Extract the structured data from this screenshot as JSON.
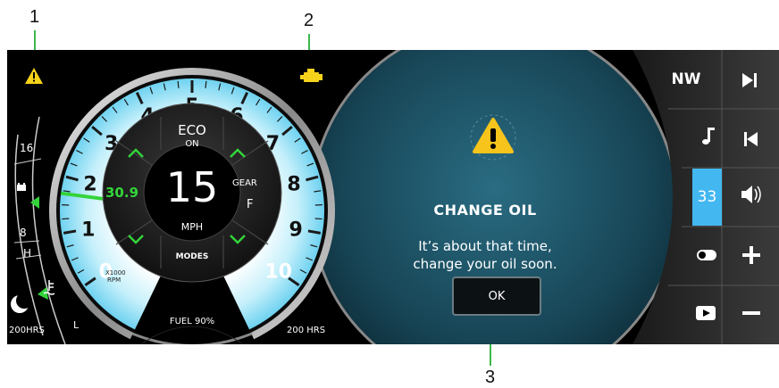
{
  "callouts": {
    "one": "1",
    "two": "2",
    "three": "3"
  },
  "gauge": {
    "tach_numbers": [
      "0",
      "1",
      "2",
      "3",
      "4",
      "5",
      "6",
      "7",
      "8",
      "9",
      "10"
    ],
    "rpm_unit_top": "X1000",
    "rpm_unit_bottom": "RPM",
    "speed": "15",
    "speed_unit": "MPH",
    "eco_label": "ECO",
    "eco_state": "ON",
    "gear_label": "GEAR",
    "gear_value": "F",
    "modes_label": "MODES",
    "trim_value": "30.9",
    "fuel_label": "FUEL 90%",
    "fuel_percent": 90,
    "rpm_value": 1.7
  },
  "left_scale": {
    "top_label": "16",
    "mid_label": "8",
    "high_label": "H",
    "low_label": "L",
    "hours_left": "200HRS"
  },
  "hours_right": "200 HRS",
  "modal": {
    "title": "CHANGE OIL",
    "message_line1": "It’s about that time,",
    "message_line2": "change your oil soon.",
    "ok_label": "OK"
  },
  "right_panel": {
    "heading": "NW",
    "volume": "33"
  },
  "colors": {
    "warning_yellow": "#f6d31b",
    "accent_green": "#33d43a",
    "glow_blue": "#8fdcf5",
    "volume_blue": "#43b7f0"
  }
}
